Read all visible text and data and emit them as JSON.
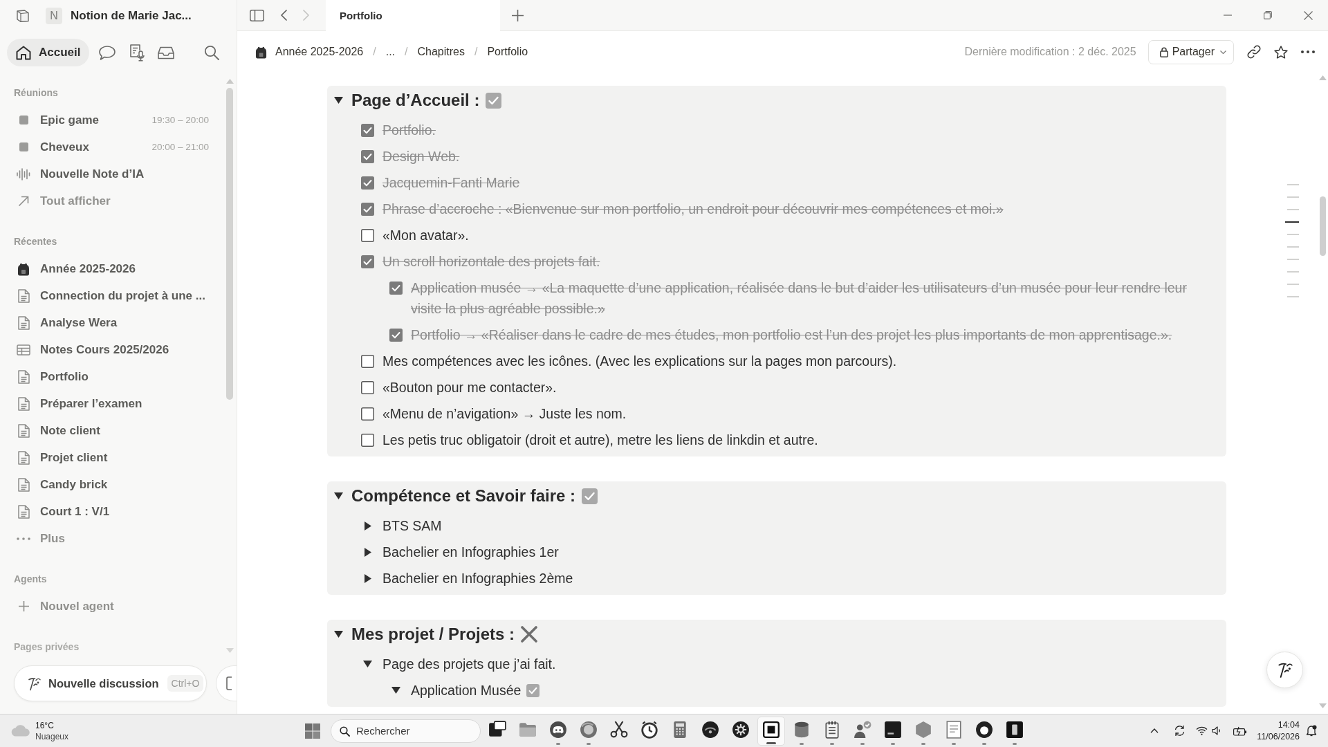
{
  "sidebar": {
    "workspace": {
      "initial": "N",
      "name": "Notion de Marie Jac..."
    },
    "home": {
      "label": "Accueil",
      "selected": true
    },
    "sections": [
      {
        "title": "Réunions",
        "items": [
          {
            "kind": "meeting",
            "label": "Epic game",
            "time": "19:30 – 20:00"
          },
          {
            "kind": "meeting",
            "label": "Cheveux",
            "time": "20:00 – 21:00"
          },
          {
            "kind": "ai_note",
            "label": "Nouvelle Note d’IA"
          },
          {
            "kind": "view_all",
            "label": "Tout afficher"
          }
        ]
      },
      {
        "title": "Récentes",
        "items": [
          {
            "kind": "emoji_page",
            "label": "Année 2025-2026"
          },
          {
            "kind": "page",
            "label": "Connection du projet à une ..."
          },
          {
            "kind": "page",
            "label": "Analyse Wera"
          },
          {
            "kind": "database",
            "label": "Notes Cours 2025/2026"
          },
          {
            "kind": "page",
            "label": "Portfolio"
          },
          {
            "kind": "page",
            "label": "Préparer l’examen"
          },
          {
            "kind": "page",
            "label": "Note client"
          },
          {
            "kind": "page",
            "label": "Projet client"
          },
          {
            "kind": "page",
            "label": "Candy brick"
          },
          {
            "kind": "page",
            "label": "Court 1 : V/1"
          },
          {
            "kind": "more",
            "label": "Plus"
          }
        ]
      },
      {
        "title": "Agents",
        "items": [
          {
            "kind": "add",
            "label": "Nouvel agent"
          }
        ]
      },
      {
        "title": "Pages privées"
      }
    ],
    "new_chat": {
      "label": "Nouvelle discussion",
      "shortcut": "Ctrl+O"
    }
  },
  "tab_bar": {
    "back": {
      "disabled": false
    },
    "forward": {
      "disabled": true
    },
    "tabs": [
      {
        "title": "Portfolio",
        "selected": true
      }
    ]
  },
  "topbar": {
    "breadcrumb": [
      {
        "kind": "emoji_page",
        "label": "Année 2025-2026"
      },
      {
        "kind": "separator",
        "label": "/"
      },
      {
        "kind": "ellipsis",
        "label": "..."
      },
      {
        "kind": "separator",
        "label": "/"
      },
      {
        "kind": "page",
        "label": "Chapitres"
      },
      {
        "kind": "separator",
        "label": "/"
      },
      {
        "kind": "page",
        "label": "Portfolio"
      }
    ],
    "last_edited": "Dernière modification : 2 déc. 2025",
    "share": {
      "label": "Partager"
    }
  },
  "page": {
    "blocks": [
      {
        "title": "Page d’Accueil :",
        "done": true,
        "expanded": true,
        "children": [
          {
            "kind": "todo",
            "text": "Portfolio.",
            "checked": true
          },
          {
            "kind": "todo",
            "text": "Design Web.",
            "checked": true
          },
          {
            "kind": "todo",
            "text": "Jacquemin-Fanti Marie",
            "checked": true
          },
          {
            "kind": "todo",
            "text": "Phrase d’accroche : «Bienvenue sur mon portfolio, un endroit pour découvrir mes compétences et moi.»",
            "checked": true
          },
          {
            "kind": "todo",
            "text": "«Mon avatar».",
            "checked": false
          },
          {
            "kind": "todo",
            "text": "Un scroll horizontale des projets fait.",
            "checked": true,
            "children": [
              {
                "kind": "todo",
                "text": "Application musée → «La maquette d’une application, réalisée dans le but d’aider les utilisateurs d’un musée pour leur rendre leur visite la plus agréable possible.»",
                "checked": true
              },
              {
                "kind": "todo",
                "text": "Portfolio → «Réaliser dans le cadre de mes études, mon portfolio est l’un des projet les plus importants de mon apprentisage.».",
                "checked": true
              }
            ]
          },
          {
            "kind": "todo",
            "text": "Mes compétences avec les icônes. (Avec les explications sur la pages mon parcours).",
            "checked": false
          },
          {
            "kind": "todo",
            "text": "«Bouton pour me contacter».",
            "checked": false
          },
          {
            "kind": "todo",
            "text": "«Menu de n’avigation» → Juste les nom.",
            "checked": false
          },
          {
            "kind": "todo",
            "text": "Les petis truc obligatoir (droit et autre), metre les liens de linkdin et autre.",
            "checked": false
          }
        ]
      },
      {
        "title": "Compétence et Savoir faire :",
        "done": true,
        "expanded": true,
        "children": [
          {
            "kind": "toggle",
            "text": "BTS SAM",
            "expanded": false
          },
          {
            "kind": "toggle",
            "text": "Bachelier en Infographies 1er",
            "expanded": false
          },
          {
            "kind": "toggle",
            "text": "Bachelier en Infographies 2ème",
            "expanded": false
          }
        ]
      },
      {
        "title": "Mes projet / Projets :",
        "done": false,
        "expanded": true,
        "children": [
          {
            "kind": "toggle",
            "text": "Page des projets que j’ai fait.",
            "expanded": true,
            "children": [
              {
                "kind": "toggle",
                "text": "Application Musée",
                "done": true,
                "expanded": true
              }
            ]
          }
        ]
      }
    ]
  },
  "taskbar": {
    "weather": {
      "temperature": "16°C",
      "condition": "Nuageux"
    },
    "search": {
      "placeholder": "Rechercher"
    },
    "apps": [
      {
        "running": false,
        "selected": false
      },
      {
        "running": false,
        "selected": false
      },
      {
        "running": true,
        "selected": false
      },
      {
        "running": true,
        "selected": false
      },
      {
        "running": false,
        "selected": false
      },
      {
        "running": false,
        "selected": false
      },
      {
        "running": false,
        "selected": false
      },
      {
        "running": false,
        "selected": false
      },
      {
        "running": false,
        "selected": false
      },
      {
        "running": true,
        "selected": true
      },
      {
        "running": true,
        "selected": false
      },
      {
        "running": true,
        "selected": false
      },
      {
        "running": true,
        "selected": false
      },
      {
        "running": true,
        "selected": false
      },
      {
        "running": true,
        "selected": false
      },
      {
        "running": true,
        "selected": false
      },
      {
        "running": true,
        "selected": false
      },
      {
        "running": true,
        "selected": false
      }
    ],
    "clock": {
      "time": "14:04",
      "date": "11/06/2026"
    }
  }
}
